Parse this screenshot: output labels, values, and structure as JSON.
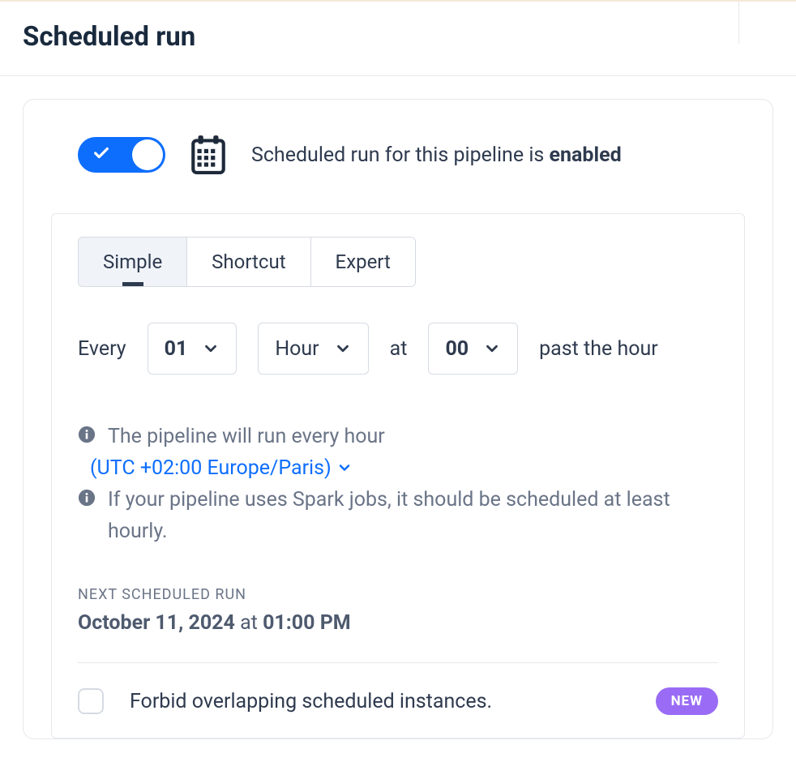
{
  "header": {
    "title": "Scheduled run"
  },
  "status": {
    "text_prefix": "Scheduled run for this pipeline is ",
    "text_state": "enabled"
  },
  "tabs": [
    {
      "label": "Simple",
      "active": true
    },
    {
      "label": "Shortcut",
      "active": false
    },
    {
      "label": "Expert",
      "active": false
    }
  ],
  "schedule": {
    "every_label": "Every",
    "interval_value": "01",
    "unit_value": "Hour",
    "at_label": "at",
    "minute_value": "00",
    "past_label": "past the hour"
  },
  "info": {
    "run_text": "The pipeline will run every hour",
    "timezone": "(UTC +02:00 Europe/Paris)",
    "spark_text": "If your pipeline uses Spark jobs, it should be scheduled at least hourly."
  },
  "next_run": {
    "label": "NEXT SCHEDULED RUN",
    "date": "October 11, 2024",
    "at": " at ",
    "time": "01:00 PM"
  },
  "forbid": {
    "label": "Forbid overlapping scheduled instances.",
    "badge": "NEW"
  }
}
